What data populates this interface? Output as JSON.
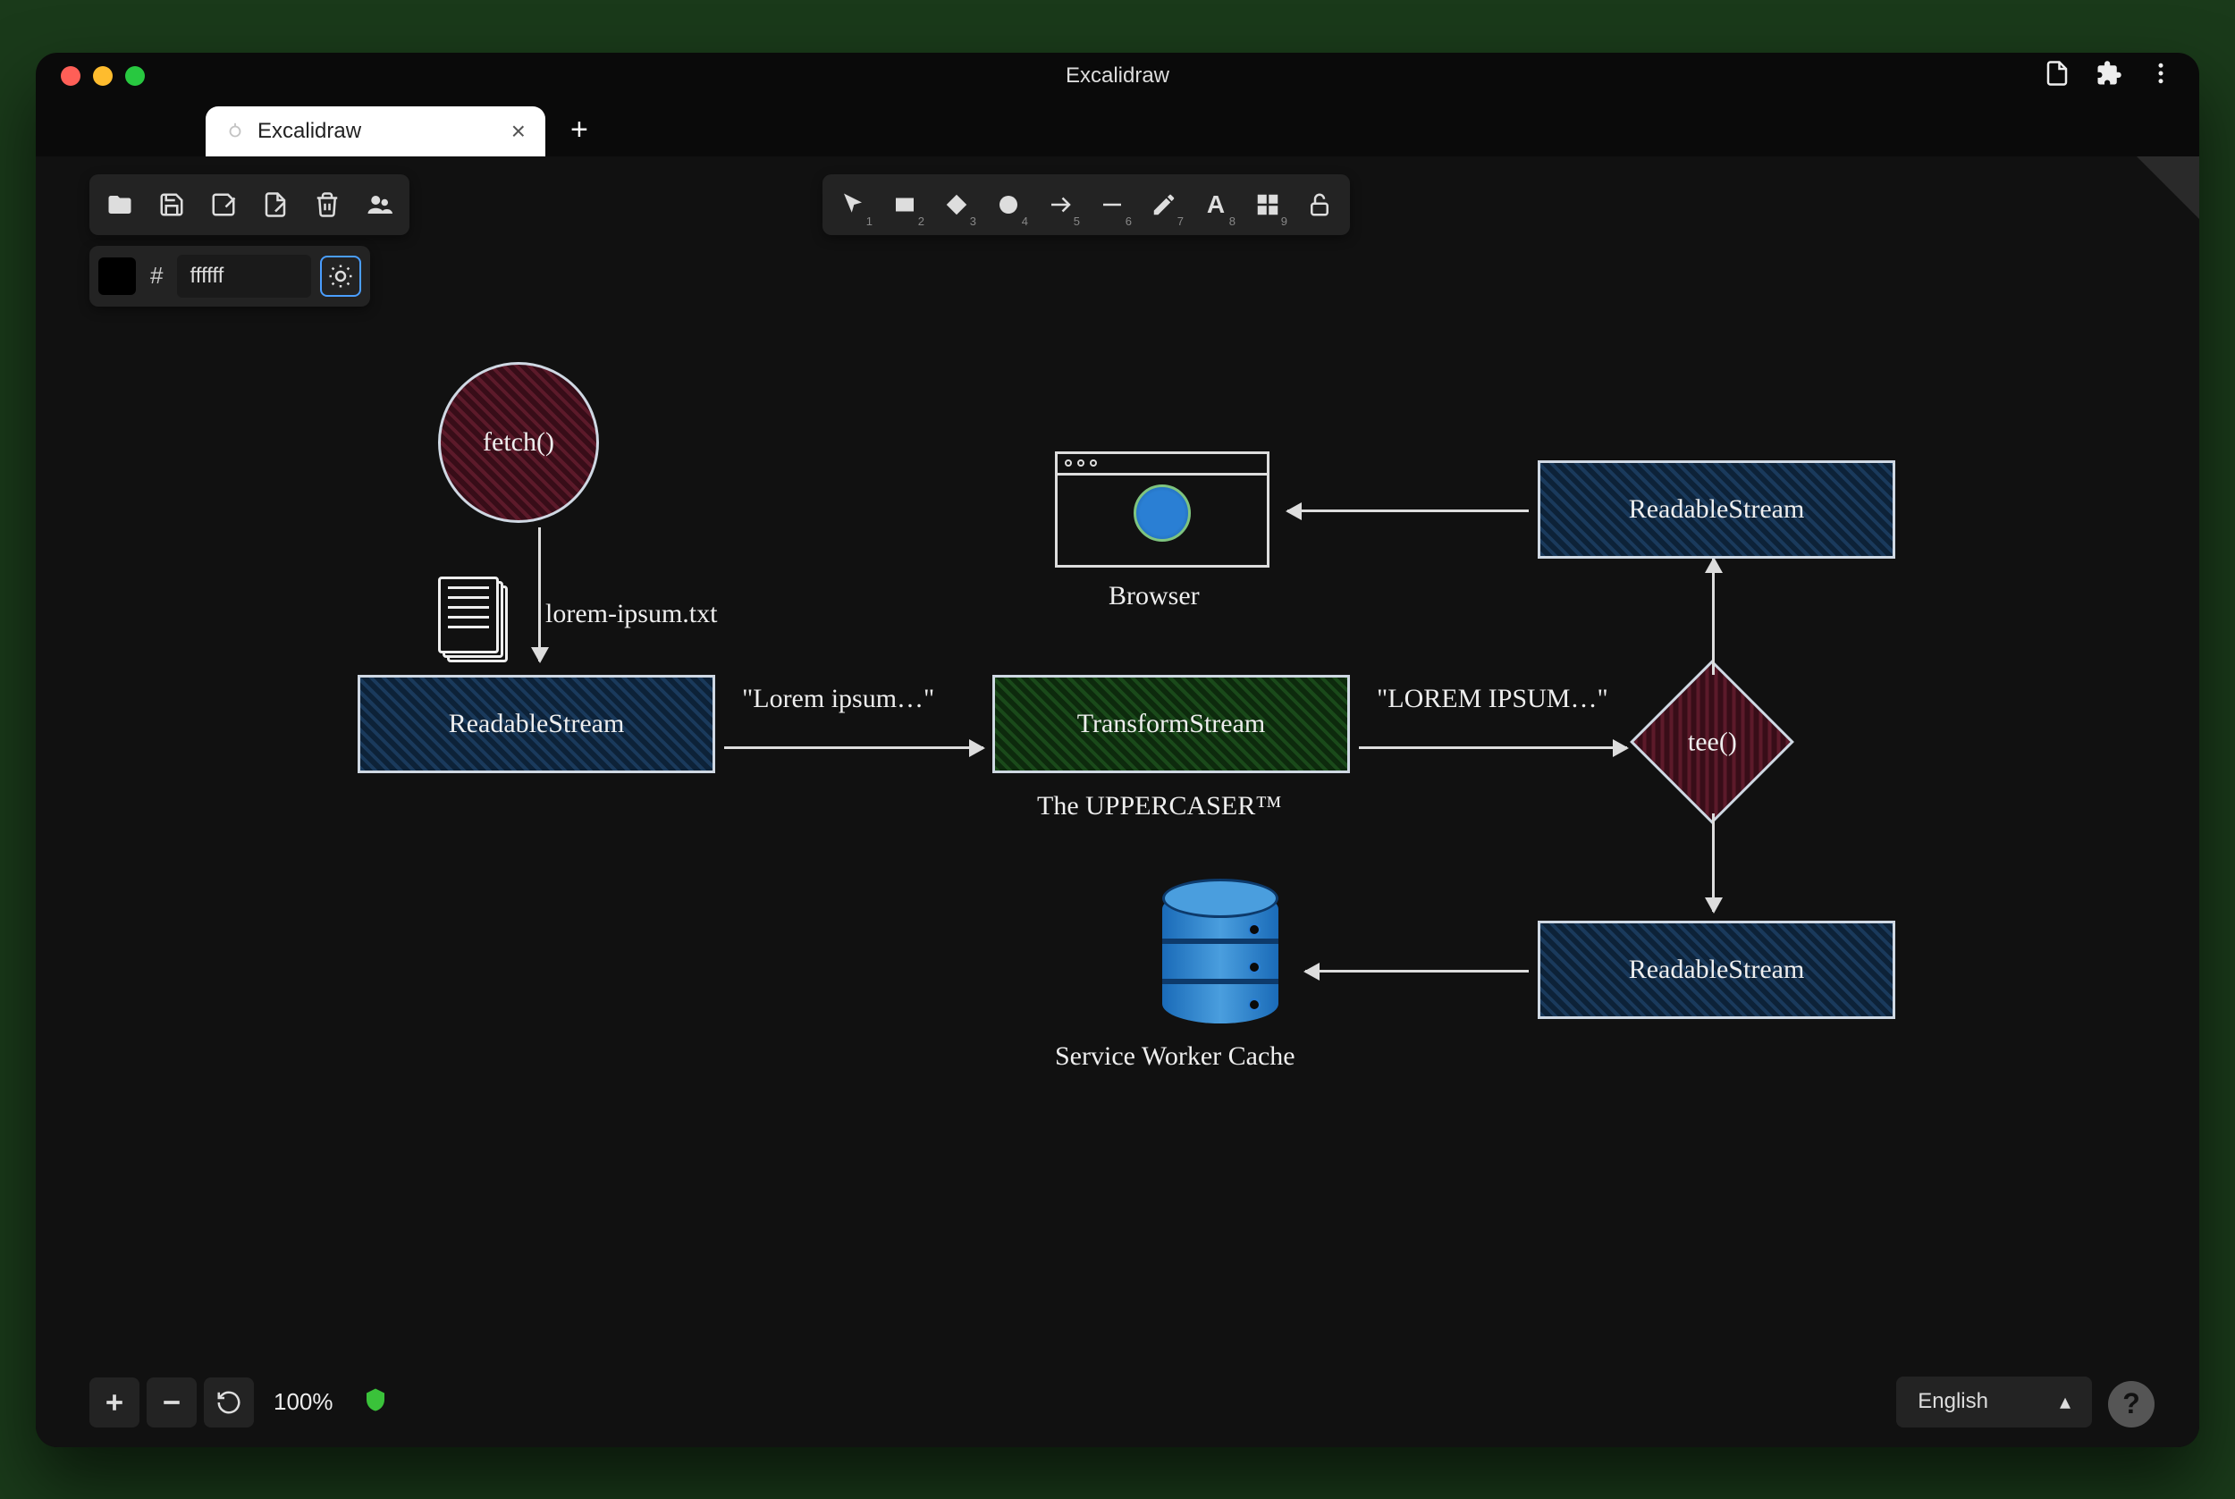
{
  "window": {
    "title": "Excalidraw",
    "tab_label": "Excalidraw"
  },
  "file_toolbar": {
    "open": "Open",
    "save": "Save",
    "saveas": "Save as",
    "export": "Export",
    "clear": "Clear",
    "collab": "Live collaboration"
  },
  "shape_toolbar": {
    "selection": "Selection",
    "rectangle": "Rectangle",
    "diamond": "Diamond",
    "ellipse": "Ellipse",
    "arrow": "Arrow",
    "line": "Line",
    "draw": "Draw",
    "text": "Text",
    "library": "Library",
    "lock": "Lock",
    "nums": {
      "sel": "1",
      "rect": "2",
      "dia": "3",
      "ell": "4",
      "arr": "5",
      "lin": "6",
      "drw": "7",
      "txt": "8",
      "lib": "9"
    }
  },
  "color": {
    "hash": "#",
    "value": "ffffff"
  },
  "diagram": {
    "fetch": "fetch()",
    "file_label": "lorem-ipsum.txt",
    "readable1": "ReadableStream",
    "lorem_lower": "\"Lorem ipsum…\"",
    "transform": "TransformStream",
    "transform_sub": "The UPPERCASER™",
    "lorem_upper": "\"LOREM IPSUM…\"",
    "tee": "tee()",
    "readable2": "ReadableStream",
    "readable3": "ReadableStream",
    "browser": "Browser",
    "swcache": "Service Worker Cache"
  },
  "footer": {
    "zoom": "100%",
    "language": "English"
  }
}
